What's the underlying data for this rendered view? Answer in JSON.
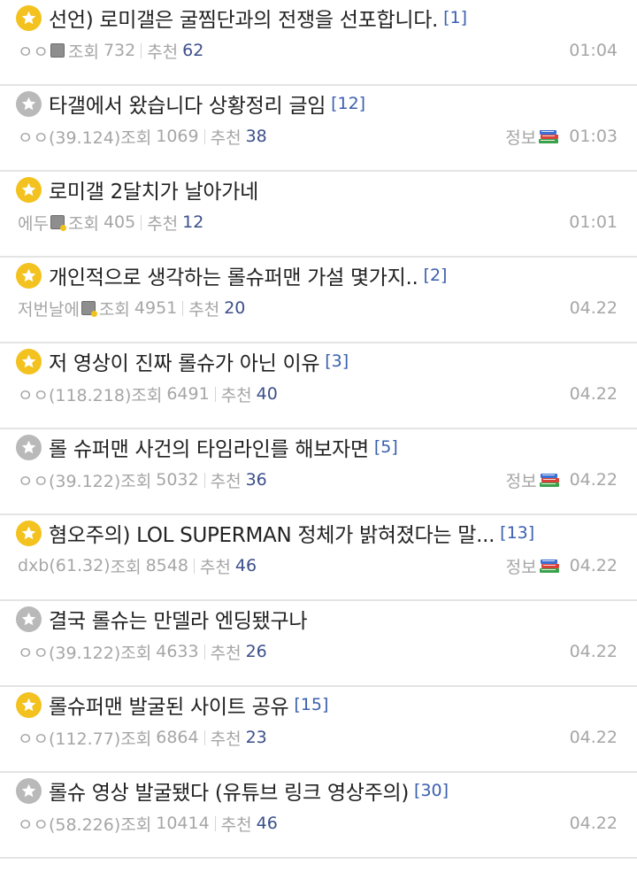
{
  "posts": [
    {
      "title": "선언) 로미갤은 굴찜단과의 전쟁을 선포합니다.",
      "replies": "[1]",
      "author": "ㅇㅇ",
      "author_icon": "plain",
      "views_label": "조회",
      "views": "732",
      "recommend_label": "추천",
      "recommend": "62",
      "category": "",
      "date": "01:04",
      "star": "gold"
    },
    {
      "title": "타갤에서 왔습니다 상황정리 글임",
      "replies": "[12]",
      "author": "ㅇㅇ(39.124)",
      "author_icon": "",
      "views_label": "조회",
      "views": "1069",
      "recommend_label": "추천",
      "recommend": "38",
      "category": "정보",
      "date": "01:03",
      "star": "gray"
    },
    {
      "title": "로미갤 2달치가 날아가네",
      "replies": "",
      "author": "에두",
      "author_icon": "gold",
      "views_label": "조회",
      "views": "405",
      "recommend_label": "추천",
      "recommend": "12",
      "category": "",
      "date": "01:01",
      "star": "gold"
    },
    {
      "title": "개인적으로 생각하는 롤슈퍼맨 가설 몇가지..",
      "replies": "[2]",
      "author": "저번날에",
      "author_icon": "gold",
      "views_label": "조회",
      "views": "4951",
      "recommend_label": "추천",
      "recommend": "20",
      "category": "",
      "date": "04.22",
      "star": "gold"
    },
    {
      "title": "저 영상이 진짜 롤슈가 아닌 이유",
      "replies": "[3]",
      "author": "ㅇㅇ(118.218)",
      "author_icon": "",
      "views_label": "조회",
      "views": "6491",
      "recommend_label": "추천",
      "recommend": "40",
      "category": "",
      "date": "04.22",
      "star": "gold"
    },
    {
      "title": "롤 슈퍼맨 사건의 타임라인를 해보자면",
      "replies": "[5]",
      "author": "ㅇㅇ(39.122)",
      "author_icon": "",
      "views_label": "조회",
      "views": "5032",
      "recommend_label": "추천",
      "recommend": "36",
      "category": "정보",
      "date": "04.22",
      "star": "gray"
    },
    {
      "title": "혐오주의) LOL SUPERMAN 정체가 밝혀졌다는 말...",
      "replies": "[13]",
      "author": "dxb(61.32)",
      "author_icon": "",
      "views_label": "조회",
      "views": "8548",
      "recommend_label": "추천",
      "recommend": "46",
      "category": "정보",
      "date": "04.22",
      "star": "gold"
    },
    {
      "title": "결국 롤슈는 만델라 엔딩됐구나",
      "replies": "",
      "author": "ㅇㅇ(39.122)",
      "author_icon": "",
      "views_label": "조회",
      "views": "4633",
      "recommend_label": "추천",
      "recommend": "26",
      "category": "",
      "date": "04.22",
      "star": "gray"
    },
    {
      "title": "롤슈퍼맨 발굴된 사이트 공유",
      "replies": "[15]",
      "author": "ㅇㅇ(112.77)",
      "author_icon": "",
      "views_label": "조회",
      "views": "6864",
      "recommend_label": "추천",
      "recommend": "23",
      "category": "",
      "date": "04.22",
      "star": "gold"
    },
    {
      "title": "롤슈 영상 발굴됐다 (유튜브 링크 영상주의)",
      "replies": "[30]",
      "author": "ㅇㅇ(58.226)",
      "author_icon": "",
      "views_label": "조회",
      "views": "10414",
      "recommend_label": "추천",
      "recommend": "46",
      "category": "",
      "date": "04.22",
      "star": "gray"
    }
  ],
  "colors": {
    "star_gold": "#f3c21f",
    "star_gray": "#b9b9b9",
    "reply_count": "#3a5fae",
    "recommend_num": "#3b4f8a",
    "meta_text": "#a6a6a6",
    "title_text": "#222222",
    "divider": "#e4e4e4"
  },
  "icons": {
    "star": "star-icon",
    "nickname_badge": "nickname-badge-icon",
    "category": "books-icon"
  }
}
